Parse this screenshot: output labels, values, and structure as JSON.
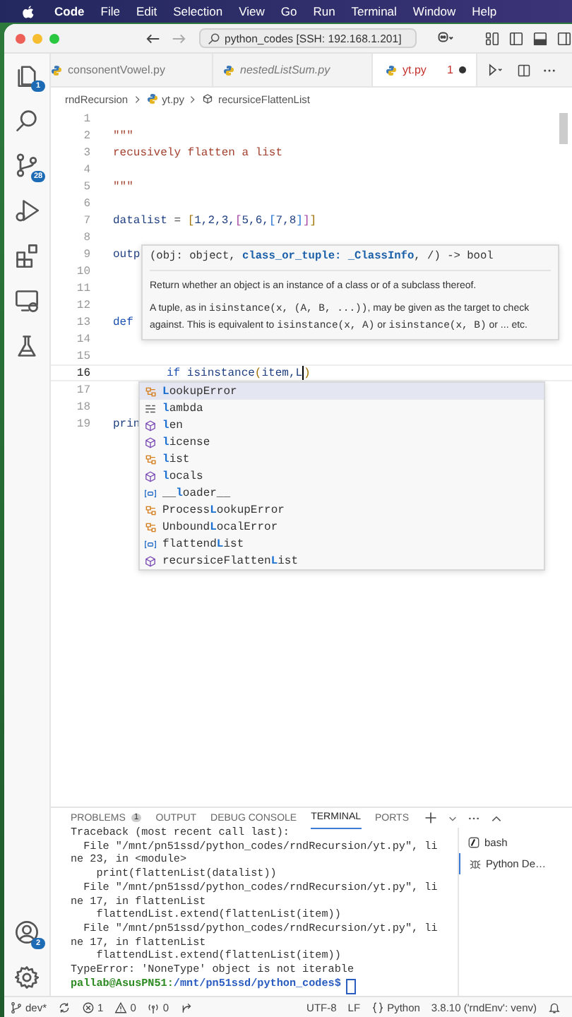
{
  "menubar": {
    "items": [
      "Code",
      "File",
      "Edit",
      "Selection",
      "View",
      "Go",
      "Run",
      "Terminal",
      "Window",
      "Help"
    ]
  },
  "titlebar": {
    "search": "python_codes [SSH: 192.168.1.201]"
  },
  "activity_bar": {
    "top": [
      {
        "kind": "files",
        "badge": "1"
      },
      {
        "kind": "search"
      },
      {
        "kind": "source-control",
        "badge": "28"
      },
      {
        "kind": "run-debug"
      },
      {
        "kind": "extensions"
      },
      {
        "kind": "remote"
      },
      {
        "kind": "testing"
      }
    ],
    "bottom": [
      {
        "kind": "account",
        "badge": "2"
      },
      {
        "kind": "settings"
      }
    ]
  },
  "tabs": [
    {
      "label": "consonentVowel.py",
      "preview": false,
      "selected": false,
      "modified": false
    },
    {
      "label": "nestedListSum.py",
      "preview": true,
      "selected": false,
      "modified": false
    },
    {
      "label": "yt.py",
      "preview": false,
      "selected": true,
      "modified": true,
      "problems": "1"
    }
  ],
  "breadcrumb": [
    {
      "label": "rndRecursion",
      "kind": "folder"
    },
    {
      "label": "yt.py",
      "kind": "python-file"
    },
    {
      "label": "recursiceFlattenList",
      "kind": "function"
    }
  ],
  "editor": {
    "lines": [
      {
        "number": "1",
        "current": false
      },
      {
        "number": "2",
        "current": false,
        "tokens": [
          {
            "text": "\"\"\"",
            "kind": "string"
          }
        ]
      },
      {
        "number": "3",
        "current": false,
        "tokens": [
          {
            "text": "recusively flatten a list",
            "kind": "string"
          }
        ]
      },
      {
        "number": "4",
        "current": false
      },
      {
        "number": "5",
        "current": false,
        "tokens": [
          {
            "text": "\"\"\"",
            "kind": "string"
          }
        ]
      },
      {
        "number": "6",
        "current": false
      },
      {
        "number": "7",
        "current": false,
        "tokens": [
          {
            "text": "datalist",
            "kind": "name"
          },
          {
            "text": " = ",
            "kind": "plain"
          },
          {
            "text": "[",
            "kind": "bracket"
          },
          {
            "text": "1,2,3,",
            "kind": "name"
          },
          {
            "text": "[",
            "kind": "bracket2"
          },
          {
            "text": "5,6,",
            "kind": "name"
          },
          {
            "text": "[",
            "kind": "bracket3"
          },
          {
            "text": "7,8",
            "kind": "name"
          },
          {
            "text": "]",
            "kind": "bracket3"
          },
          {
            "text": "]",
            "kind": "bracket2"
          },
          {
            "text": "]",
            "kind": "bracket"
          }
        ]
      },
      {
        "number": "8",
        "current": false
      },
      {
        "number": "9",
        "current": false,
        "tokens": [
          {
            "text": "outp",
            "kind": "name"
          }
        ]
      },
      {
        "number": "10",
        "current": false
      },
      {
        "number": "11",
        "current": false
      },
      {
        "number": "12",
        "current": false
      },
      {
        "number": "13",
        "current": false,
        "tokens": [
          {
            "text": "def",
            "kind": "keyword"
          }
        ]
      },
      {
        "number": "14",
        "current": false
      },
      {
        "number": "15",
        "current": false
      },
      {
        "number": "16",
        "current": true,
        "tokens": [
          {
            "kind": "indent"
          },
          {
            "text": "if",
            "kind": "keyword"
          },
          {
            "text": " isinstance",
            "kind": "name"
          },
          {
            "text": "(",
            "kind": "bracket"
          },
          {
            "text": "item,L",
            "kind": "name"
          },
          {
            "kind": "cursor"
          },
          {
            "text": ")",
            "kind": "bracket"
          }
        ]
      },
      {
        "number": "17",
        "current": false
      },
      {
        "number": "18",
        "current": false
      },
      {
        "number": "19",
        "current": false,
        "tokens": [
          {
            "text": "prin",
            "kind": "name"
          }
        ]
      }
    ]
  },
  "hover": {
    "signature": [
      {
        "text": "(obj: object, ",
        "kind": "plain"
      },
      {
        "text": "class_or_tuple: _ClassInfo",
        "kind": "param"
      },
      {
        "text": ", /) -> bool",
        "kind": "plain"
      }
    ],
    "paragraphs": [
      [
        {
          "text": "Return whether an object is an instance of a class or of a subclass thereof.",
          "kind": "text"
        }
      ],
      [
        {
          "text": "A tuple, as in ",
          "kind": "text"
        },
        {
          "text": "isinstance(x, (A, B, ...))",
          "kind": "code"
        },
        {
          "text": ", may be given as the target to check against. This is equivalent to ",
          "kind": "text"
        },
        {
          "text": "isinstance(x, A)",
          "kind": "code"
        },
        {
          "text": " or ",
          "kind": "text"
        },
        {
          "text": "isinstance(x, B)",
          "kind": "code"
        },
        {
          "text": " or ... etc.",
          "kind": "text"
        }
      ]
    ]
  },
  "suggest": {
    "items": [
      {
        "label": "**L**ookupError",
        "kind": "class",
        "selected": true
      },
      {
        "label": "**l**ambda",
        "kind": "keyword",
        "selected": false
      },
      {
        "label": "**l**en",
        "kind": "function",
        "selected": false
      },
      {
        "label": "**l**icense",
        "kind": "function",
        "selected": false
      },
      {
        "label": "**l**ist",
        "kind": "class",
        "selected": false
      },
      {
        "label": "**l**ocals",
        "kind": "function",
        "selected": false
      },
      {
        "label": "__**l**oader__",
        "kind": "variable",
        "selected": false
      },
      {
        "label": "Process**L**ookupError",
        "kind": "class",
        "selected": false
      },
      {
        "label": "Unbound**L**ocalError",
        "kind": "class",
        "selected": false
      },
      {
        "label": "flattend**L**ist",
        "kind": "variable",
        "selected": false
      },
      {
        "label": "recursiceFlatten**L**ist",
        "kind": "function",
        "selected": false
      }
    ]
  },
  "panel": {
    "tabs": [
      {
        "label": "PROBLEMS",
        "badge": "1",
        "selected": false
      },
      {
        "label": "OUTPUT",
        "selected": false
      },
      {
        "label": "DEBUG CONSOLE",
        "selected": false
      },
      {
        "label": "TERMINAL",
        "selected": true
      },
      {
        "label": "PORTS",
        "selected": false
      }
    ],
    "terminal_lines": [
      {
        "kind": "output",
        "text": "Traceback (most recent call last):"
      },
      {
        "kind": "output",
        "text": "  File \"/mnt/pn51ssd/python_codes/rndRecursion/yt.py\", li"
      },
      {
        "kind": "output",
        "text": "ne 23, in <module>"
      },
      {
        "kind": "output",
        "text": "    print(flattenList(datalist))"
      },
      {
        "kind": "output",
        "text": "  File \"/mnt/pn51ssd/python_codes/rndRecursion/yt.py\", li"
      },
      {
        "kind": "output",
        "text": "ne 17, in flattenList"
      },
      {
        "kind": "output",
        "text": "    flattendList.extend(flattenList(item))"
      },
      {
        "kind": "output",
        "text": "  File \"/mnt/pn51ssd/python_codes/rndRecursion/yt.py\", li"
      },
      {
        "kind": "output",
        "text": "ne 17, in flattenList"
      },
      {
        "kind": "output",
        "text": "    flattendList.extend(flattenList(item))"
      },
      {
        "kind": "output",
        "text": "TypeError: 'NoneType' object is not iterable"
      },
      {
        "kind": "prompt",
        "user": "pallab@AsusPN51:",
        "path": "/mnt/pn51ssd/python_codes$"
      }
    ],
    "terminals": [
      {
        "label": "bash",
        "kind": "shell",
        "selected": false
      },
      {
        "label": "Python De…",
        "kind": "debug",
        "selected": true
      }
    ]
  },
  "status_bar": {
    "left": [
      {
        "kind": "branch",
        "text": "dev*"
      },
      {
        "kind": "sync"
      },
      {
        "kind": "errors",
        "text": "1"
      },
      {
        "kind": "warnings",
        "text": "0"
      },
      {
        "kind": "ports",
        "text": "0"
      },
      {
        "kind": "live-share"
      }
    ],
    "right": [
      {
        "kind": "text",
        "text": "UTF-8"
      },
      {
        "kind": "text",
        "text": "LF"
      },
      {
        "kind": "language",
        "text": "Python"
      },
      {
        "kind": "text",
        "text": "3.8.10 ('rndEnv': venv)"
      },
      {
        "kind": "bell"
      }
    ]
  }
}
